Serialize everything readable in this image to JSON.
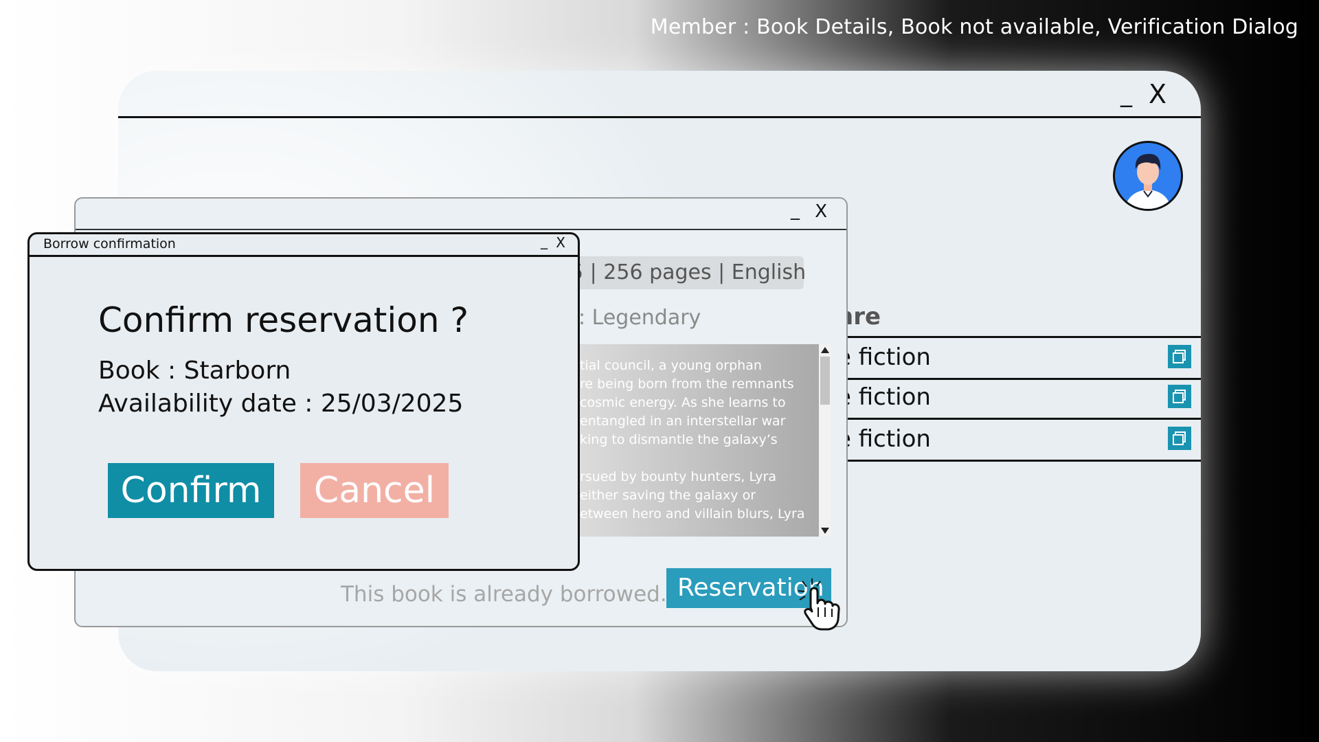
{
  "caption": "Member : Book Details, Book not available, Verification Dialog",
  "main_window": {
    "minimize_label": "_",
    "close_label": "X",
    "genre_header": "nre",
    "genre_rows": [
      "e fiction",
      "e fiction",
      "e fiction"
    ]
  },
  "details_window": {
    "minimize_label": "_",
    "close_label": "X",
    "meta": "5 | 256 pages | English",
    "rarity": ": Legendary",
    "synopsis_lines": [
      "tial council, a young orphan",
      "re being born from the remnants",
      "cosmic energy. As she learns to",
      "entangled in an interstellar war",
      "king to dismantle the galaxy’s",
      "",
      "rsued by bounty hunters, Lyra",
      "either saving the galaxy or",
      "etween hero and villain blurs, Lyra"
    ],
    "borrowed_note": "This book is already borrowed.",
    "reservation_label": "Reservation"
  },
  "dialog": {
    "title": "Borrow confirmation",
    "minimize_label": "_",
    "close_label": "X",
    "heading": "Confirm reservation ?",
    "book_line": "Book : Starborn",
    "availability_line": "Availability date : 25/03/2025",
    "confirm_label": "Confirm",
    "cancel_label": "Cancel"
  },
  "colors": {
    "accent": "#0f8ea6",
    "reservation": "#2a9cbc",
    "cancel": "#f2b0a5",
    "copy_icon": "#1a93b0",
    "avatar_bg": "#2f7ff0"
  },
  "icons": [
    "user-avatar-icon",
    "copy-icon",
    "pointer-hand-icon",
    "scroll-up-icon",
    "scroll-down-icon"
  ]
}
